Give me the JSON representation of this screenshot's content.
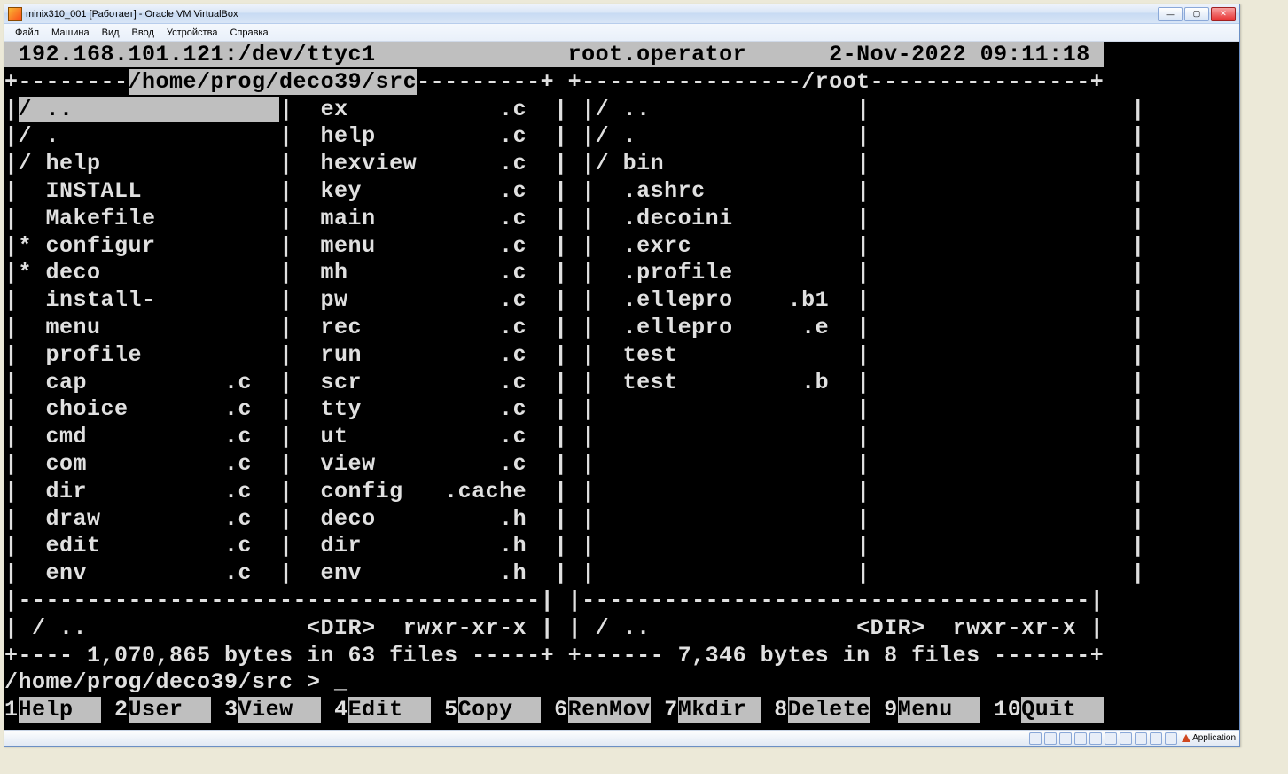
{
  "window": {
    "title": "minix310_001 [Работает] - Oracle VM VirtualBox"
  },
  "menubar": {
    "items": [
      "Файл",
      "Машина",
      "Вид",
      "Ввод",
      "Устройства",
      "Справка"
    ]
  },
  "terminal": {
    "header_ip": "192.168.101.121:/dev/ttyc1",
    "header_user": "root.operator",
    "header_date": "2-Nov-2022 09:11:18",
    "left_path": "/home/prog/deco39/src",
    "right_path": "/root",
    "left_panel": {
      "columns": [
        [
          {
            "p": "/",
            "n": "..",
            "e": "",
            "sel": true
          },
          {
            "p": "/",
            "n": ".",
            "e": ""
          },
          {
            "p": "/",
            "n": "help",
            "e": ""
          },
          {
            "p": " ",
            "n": "INSTALL",
            "e": ""
          },
          {
            "p": " ",
            "n": "Makefile",
            "e": ""
          },
          {
            "p": "*",
            "n": "configure",
            "e": ""
          },
          {
            "p": "*",
            "n": "deco",
            "e": ""
          },
          {
            "p": " ",
            "n": "install-sh",
            "e": ""
          },
          {
            "p": " ",
            "n": "menu",
            "e": ""
          },
          {
            "p": " ",
            "n": "profile",
            "e": ""
          },
          {
            "p": " ",
            "n": "cap",
            "e": ".c"
          },
          {
            "p": " ",
            "n": "choice",
            "e": ".c"
          },
          {
            "p": " ",
            "n": "cmd",
            "e": ".c"
          },
          {
            "p": " ",
            "n": "com",
            "e": ".c"
          },
          {
            "p": " ",
            "n": "dir",
            "e": ".c"
          },
          {
            "p": " ",
            "n": "draw",
            "e": ".c"
          },
          {
            "p": " ",
            "n": "edit",
            "e": ".c"
          },
          {
            "p": " ",
            "n": "env",
            "e": ".c"
          }
        ],
        [
          {
            "p": " ",
            "n": "ex",
            "e": ".c"
          },
          {
            "p": " ",
            "n": "help",
            "e": ".c"
          },
          {
            "p": " ",
            "n": "hexview",
            "e": ".c"
          },
          {
            "p": " ",
            "n": "key",
            "e": ".c"
          },
          {
            "p": " ",
            "n": "main",
            "e": ".c"
          },
          {
            "p": " ",
            "n": "menu",
            "e": ".c"
          },
          {
            "p": " ",
            "n": "mh",
            "e": ".c"
          },
          {
            "p": " ",
            "n": "pw",
            "e": ".c"
          },
          {
            "p": " ",
            "n": "rec",
            "e": ".c"
          },
          {
            "p": " ",
            "n": "run",
            "e": ".c"
          },
          {
            "p": " ",
            "n": "scr",
            "e": ".c"
          },
          {
            "p": " ",
            "n": "tty",
            "e": ".c"
          },
          {
            "p": " ",
            "n": "ut",
            "e": ".c"
          },
          {
            "p": " ",
            "n": "view",
            "e": ".c"
          },
          {
            "p": " ",
            "n": "config",
            "e": ".cache"
          },
          {
            "p": " ",
            "n": "deco",
            "e": ".h"
          },
          {
            "p": " ",
            "n": "dir",
            "e": ".h"
          },
          {
            "p": " ",
            "n": "env",
            "e": ".h"
          }
        ]
      ],
      "status_left": "/ ..",
      "status_mid": "<DIR>",
      "status_right": "rwxr-xr-x",
      "footer": "1,070,865 bytes in 63 files"
    },
    "right_panel": {
      "columns": [
        [
          {
            "p": "/",
            "n": "..",
            "e": ""
          },
          {
            "p": "/",
            "n": ".",
            "e": ""
          },
          {
            "p": "/",
            "n": "bin",
            "e": ""
          },
          {
            "p": " ",
            "n": ".ashrc",
            "e": ""
          },
          {
            "p": " ",
            "n": ".decoini",
            "e": ""
          },
          {
            "p": " ",
            "n": ".exrc",
            "e": ""
          },
          {
            "p": " ",
            "n": ".profile",
            "e": ""
          },
          {
            "p": " ",
            "n": ".ellepro",
            "e": ".b1"
          },
          {
            "p": " ",
            "n": ".ellepro",
            "e": ".e"
          },
          {
            "p": " ",
            "n": "test",
            "e": ""
          },
          {
            "p": " ",
            "n": "test",
            "e": ".b"
          }
        ],
        []
      ],
      "status_left": "/ ..",
      "status_mid": "<DIR>",
      "status_right": "rwxr-xr-x",
      "footer": "7,346 bytes in 8 files"
    },
    "prompt": "/home/prog/deco39/src >",
    "fkeys": [
      {
        "n": "1",
        "l": "Help"
      },
      {
        "n": "2",
        "l": "User"
      },
      {
        "n": "3",
        "l": "View"
      },
      {
        "n": "4",
        "l": "Edit"
      },
      {
        "n": "5",
        "l": "Copy"
      },
      {
        "n": "6",
        "l": "RenMov"
      },
      {
        "n": "7",
        "l": "Mkdir"
      },
      {
        "n": "8",
        "l": "Delete"
      },
      {
        "n": "9",
        "l": "Menu"
      },
      {
        "n": "10",
        "l": "Quit"
      }
    ]
  },
  "statusbar": {
    "app_label": "Application"
  }
}
